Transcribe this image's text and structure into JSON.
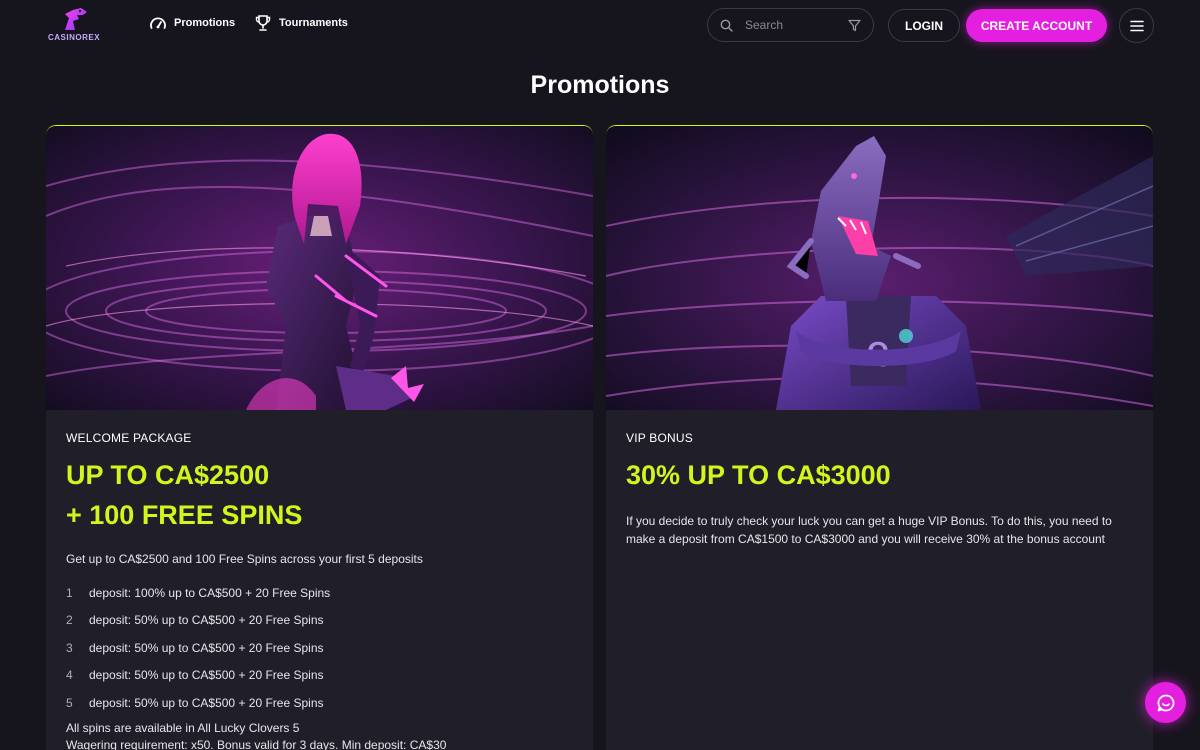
{
  "brand": {
    "logo_text": "CASINOREX",
    "accent": "#e41fe0",
    "highlight": "#d4f51c"
  },
  "nav": [
    {
      "label": "Promotions",
      "icon": "speedometer-icon"
    },
    {
      "label": "Tournaments",
      "icon": "trophy-icon"
    }
  ],
  "search": {
    "placeholder": "Search"
  },
  "header": {
    "login_label": "LOGIN",
    "create_label": "CREATE ACCOUNT"
  },
  "page": {
    "title": "Promotions"
  },
  "promos": [
    {
      "kicker": "WELCOME PACKAGE",
      "headline_line1": "UP TO CA$2500",
      "headline_line2": "+ 100 FREE SPINS",
      "description": "Get up to CA$2500 and 100 Free Spins across your first 5 deposits",
      "deposits": [
        {
          "num": "1",
          "text": "deposit: 100% up to CA$500 + 20 Free Spins"
        },
        {
          "num": "2",
          "text": "deposit: 50% up to CA$500 + 20 Free Spins"
        },
        {
          "num": "3",
          "text": "deposit: 50% up to CA$500 + 20 Free Spins"
        },
        {
          "num": "4",
          "text": "deposit: 50% up to CA$500 + 20 Free Spins"
        },
        {
          "num": "5",
          "text": "deposit: 50% up to CA$500 + 20 Free Spins"
        }
      ],
      "foot_line1": "All spins are available in All Lucky Clovers 5",
      "foot_line2": "Wagering requirement: x50. Bonus valid for 3 days. Min deposit: CA$30"
    },
    {
      "kicker": "VIP BONUS",
      "headline_line1": "30% UP TO CA$3000",
      "description": "If you decide to truly check your luck you can get a huge VIP Bonus. To do this, you need to make a deposit from CA$1500 to CA$3000 and you will receive 30% at the bonus account"
    }
  ]
}
